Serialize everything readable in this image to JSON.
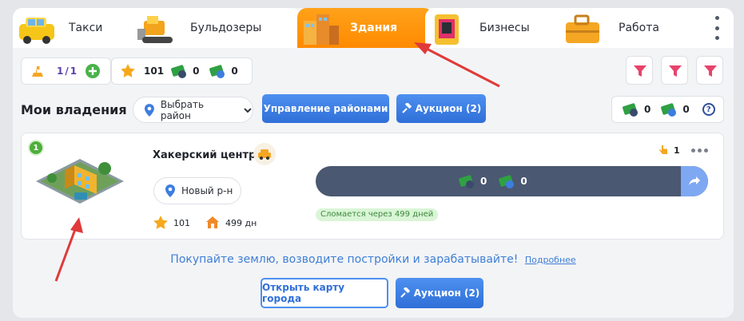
{
  "tabs": [
    {
      "label": "Такси",
      "active": false
    },
    {
      "label": "Бульдозеры",
      "active": false
    },
    {
      "label": "Здания",
      "active": true
    },
    {
      "label": "Бизнесы",
      "active": false
    },
    {
      "label": "Работа",
      "active": false
    }
  ],
  "stats": {
    "slots": "1",
    "slots_sep": "/",
    "slots_total": "1",
    "stars": "101",
    "cash_a": "0",
    "cash_b": "0"
  },
  "header": {
    "title": "Мои владения",
    "district_select": "Выбрать район",
    "manage_button": "Управление районами",
    "auction_button": "Аукцион (2)",
    "wallet_a": "0",
    "wallet_b": "0",
    "help": "?"
  },
  "property": {
    "level": "1",
    "name": "Хакерский центр",
    "district": "Новый р-н",
    "likes": "1",
    "stars": "101",
    "days": "499 дн",
    "income_a": "0",
    "income_b": "0",
    "break_note": "Сломается через 499 дней"
  },
  "footer": {
    "promo": "Покупайте землю, возводите постройки и зарабатывайте!",
    "more_link": "Подробнее",
    "open_map_button": "Открыть карту города",
    "auction_button": "Аукцион (2)"
  },
  "colors": {
    "accent_orange": "#ff9a0e",
    "primary_blue": "#3a7ee6",
    "progress_bg": "#4a5871",
    "filter_pink": "#e8436a",
    "annotation_red": "#e03a3a"
  }
}
